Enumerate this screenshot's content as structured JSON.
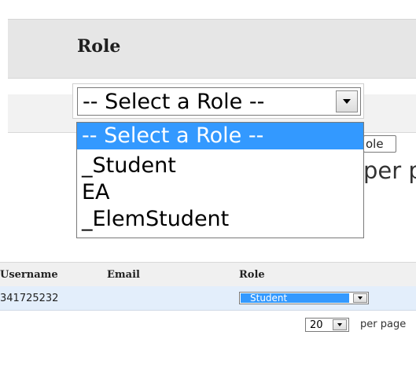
{
  "zoom": {
    "heading": "Role",
    "select": {
      "value": "-- Select a Role --"
    },
    "dropdown": {
      "options": [
        "-- Select a Role --",
        "_Student",
        "EA",
        "_ElemStudent"
      ],
      "selected_index": 0
    },
    "tooltip": "ole",
    "behind_text": "per p"
  },
  "table": {
    "columns": [
      "Username",
      "Email",
      "Role"
    ],
    "rows": [
      {
        "username": "341725232",
        "email": "",
        "role": "_Student"
      }
    ]
  },
  "pagination": {
    "per_page_value": "20",
    "per_page_label": "per page"
  },
  "colors": {
    "selection_blue": "#3399ff",
    "row_highlight": "#e3eefb",
    "header_bg": "#f0f0f0"
  }
}
